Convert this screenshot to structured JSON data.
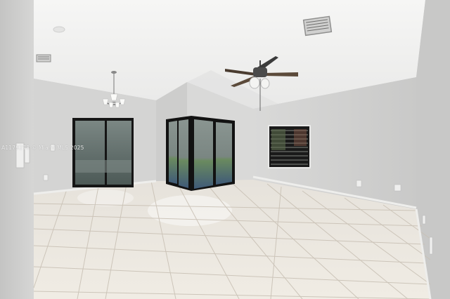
{
  "photo": {
    "subject": "empty-room-interior",
    "watermark_text": "A1179278 © Miami MLS 2025"
  },
  "colors": {
    "ceiling": "#f4f4f2",
    "wall": "#dcdcdb",
    "wall_shade": "#c9c9c8",
    "floor_tile": "#ece8e0",
    "grout": "#c7bfb3",
    "door_frame": "#151515",
    "glass": "#5f6d6a"
  },
  "objects": [
    "ceiling-fan",
    "chandelier",
    "sliding-glass-door-left",
    "sliding-glass-door-center",
    "window-right",
    "ac-vent-ceiling",
    "ac-vent-wall",
    "light-switch-plate"
  ]
}
